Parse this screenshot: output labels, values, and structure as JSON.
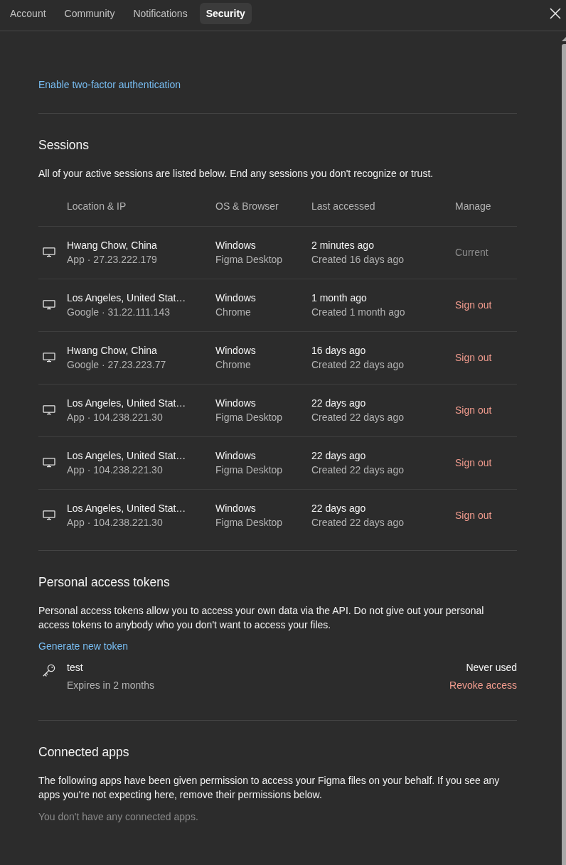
{
  "tabs": [
    {
      "label": "Account",
      "selected": false
    },
    {
      "label": "Community",
      "selected": false
    },
    {
      "label": "Notifications",
      "selected": false
    },
    {
      "label": "Security",
      "selected": true
    }
  ],
  "two_factor_link": "Enable two-factor authentication",
  "sessions": {
    "title": "Sessions",
    "description": "All of your active sessions are listed below. End any sessions you don't recognize or trust.",
    "columns": [
      "Location & IP",
      "OS & Browser",
      "Last accessed",
      "Manage"
    ],
    "rows": [
      {
        "location": "Hwang Chow, China",
        "source": "App · 27.23.222.179",
        "os": "Windows",
        "browser": "Figma Desktop",
        "last_accessed": "2 minutes ago",
        "created": "Created 16 days ago",
        "action": {
          "kind": "current",
          "label": "Current"
        }
      },
      {
        "location": "Los Angeles, United Stat…",
        "source": "Google · 31.22.111.143",
        "os": "Windows",
        "browser": "Chrome",
        "last_accessed": "1 month ago",
        "created": "Created 1 month ago",
        "action": {
          "kind": "sign_out",
          "label": "Sign out"
        }
      },
      {
        "location": "Hwang Chow, China",
        "source": "Google · 27.23.223.77",
        "os": "Windows",
        "browser": "Chrome",
        "last_accessed": "16 days ago",
        "created": "Created 22 days ago",
        "action": {
          "kind": "sign_out",
          "label": "Sign out"
        }
      },
      {
        "location": "Los Angeles, United Stat…",
        "source": "App · 104.238.221.30",
        "os": "Windows",
        "browser": "Figma Desktop",
        "last_accessed": "22 days ago",
        "created": "Created 22 days ago",
        "action": {
          "kind": "sign_out",
          "label": "Sign out"
        }
      },
      {
        "location": "Los Angeles, United Stat…",
        "source": "App · 104.238.221.30",
        "os": "Windows",
        "browser": "Figma Desktop",
        "last_accessed": "22 days ago",
        "created": "Created 22 days ago",
        "action": {
          "kind": "sign_out",
          "label": "Sign out"
        }
      },
      {
        "location": "Los Angeles, United Stat…",
        "source": "App · 104.238.221.30",
        "os": "Windows",
        "browser": "Figma Desktop",
        "last_accessed": "22 days ago",
        "created": "Created 22 days ago",
        "action": {
          "kind": "sign_out",
          "label": "Sign out"
        }
      }
    ]
  },
  "tokens": {
    "title": "Personal access tokens",
    "description": "Personal access tokens allow you to access your own data via the API. Do not give out your personal access tokens to anybody who you don't want to access your files.",
    "generate_link": "Generate new token",
    "items": [
      {
        "name": "test",
        "expires": "Expires in 2 months",
        "usage": "Never used",
        "action": "Revoke access"
      }
    ]
  },
  "connected_apps": {
    "title": "Connected apps",
    "description": "The following apps have been given permission to access your Figma files on your behalf. If you see any apps you're not expecting here, remove their permissions below.",
    "empty": "You don't have any connected apps."
  }
}
